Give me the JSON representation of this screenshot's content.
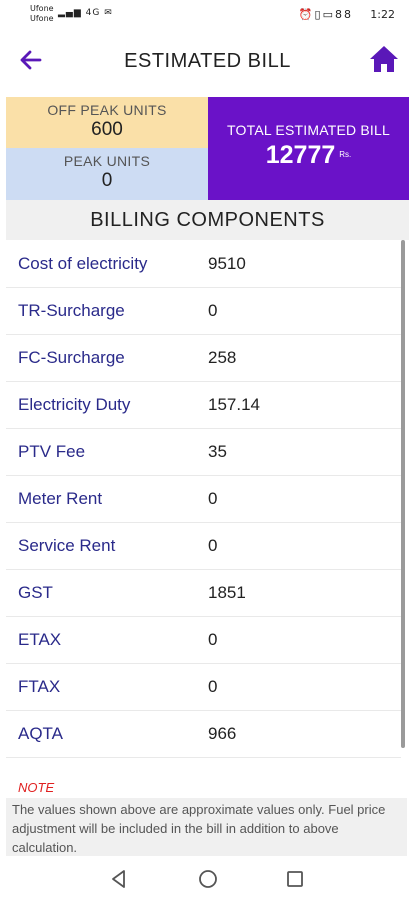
{
  "status": {
    "carrier1": "Ufone",
    "carrier2": "Ufone",
    "signal": "4G",
    "battery": "88",
    "time": "1:22"
  },
  "appbar": {
    "title": "ESTIMATED BILL",
    "back_icon": "arrow-left-icon",
    "home_icon": "home-icon"
  },
  "summary": {
    "offpeak_label": "OFF PEAK UNITS",
    "offpeak_value": "600",
    "peak_label": "PEAK UNITS",
    "peak_value": "0",
    "total_label": "TOTAL ESTIMATED BILL",
    "total_value": "12777",
    "currency": "Rs."
  },
  "billing": {
    "header": "BILLING COMPONENTS",
    "rows": [
      {
        "name": "Cost of electricity",
        "value": "9510"
      },
      {
        "name": "TR-Surcharge",
        "value": "0"
      },
      {
        "name": "FC-Surcharge",
        "value": "258"
      },
      {
        "name": "Electricity Duty",
        "value": "157.14"
      },
      {
        "name": "PTV Fee",
        "value": "35"
      },
      {
        "name": "Meter Rent",
        "value": "0"
      },
      {
        "name": "Service Rent",
        "value": "0"
      },
      {
        "name": "GST",
        "value": "1851"
      },
      {
        "name": "ETAX",
        "value": "0"
      },
      {
        "name": "FTAX",
        "value": "0"
      },
      {
        "name": "AQTA",
        "value": "966"
      }
    ]
  },
  "note": {
    "title": "NOTE",
    "text": "The values shown above are approximate values only. Fuel price adjustment will be included in the bill in addition to above calculation."
  },
  "colors": {
    "accent": "#6a12c8",
    "offpeak_bg": "#fae0a8",
    "peak_bg": "#cddcf3",
    "note_red": "#e02020"
  }
}
